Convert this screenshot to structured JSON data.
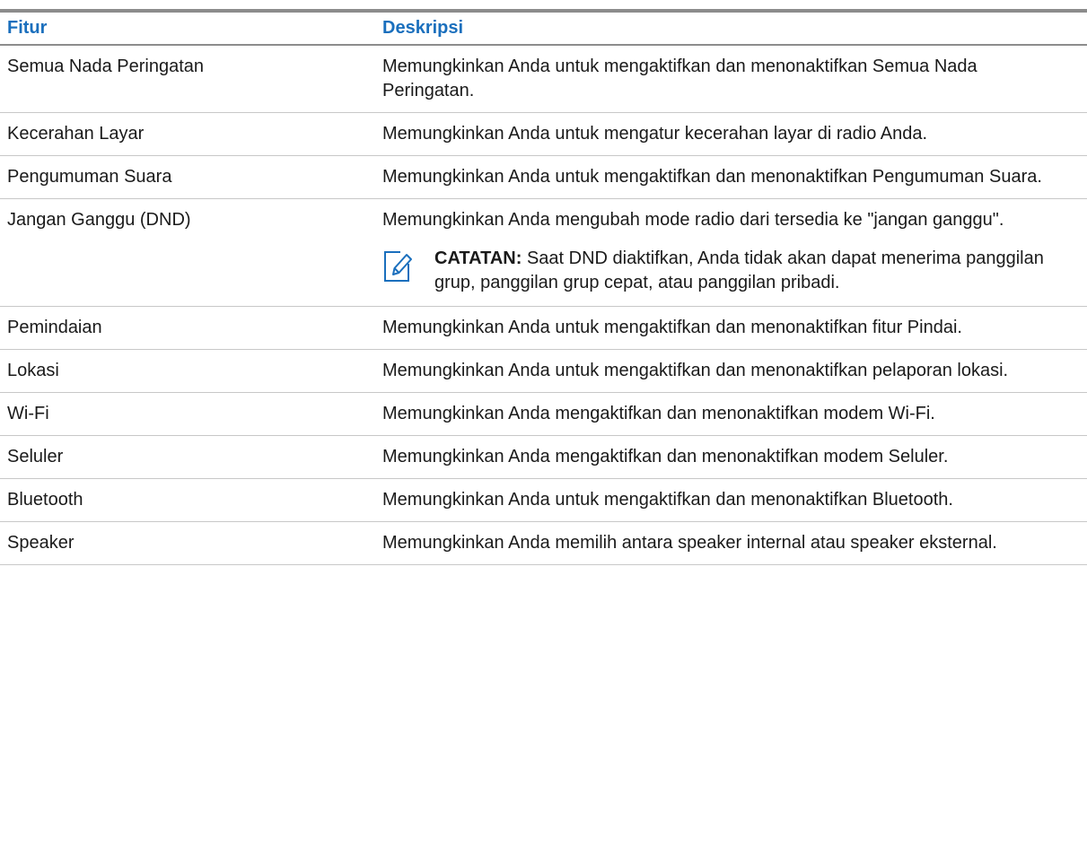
{
  "table": {
    "headers": {
      "feature": "Fitur",
      "description": "Deskripsi"
    },
    "rows": [
      {
        "feature": "Semua Nada Peringatan",
        "description": "Memungkinkan Anda untuk mengaktifkan dan menonaktifkan Semua Nada Peringatan."
      },
      {
        "feature": "Kecerahan Layar",
        "description": "Memungkinkan Anda untuk mengatur kecerahan layar di radio Anda."
      },
      {
        "feature": "Pengumuman Suara",
        "description": "Memungkinkan Anda untuk mengaktifkan dan menonaktifkan Pengumuman Suara."
      },
      {
        "feature": "Jangan Ganggu (DND)",
        "description": "Memungkinkan Anda mengubah mode radio dari tersedia ke \"jangan ganggu\".",
        "note": {
          "icon": "note-edit-icon",
          "label": "CATATAN:",
          "text": "Saat DND diaktifkan, Anda tidak akan dapat menerima panggilan grup, panggilan grup cepat, atau panggilan pribadi."
        }
      },
      {
        "feature": "Pemindaian",
        "description": "Memungkinkan Anda untuk mengaktifkan dan menonaktifkan fitur Pindai."
      },
      {
        "feature": "Lokasi",
        "description": "Memungkinkan Anda untuk mengaktifkan dan menonaktifkan pelaporan lokasi."
      },
      {
        "feature": "Wi-Fi",
        "description": "Memungkinkan Anda mengaktifkan dan menonaktifkan modem Wi-Fi."
      },
      {
        "feature": "Seluler",
        "description": "Memungkinkan Anda mengaktifkan dan menonaktifkan modem Seluler."
      },
      {
        "feature": "Bluetooth",
        "description": "Memungkinkan Anda untuk mengaktifkan dan menonaktifkan Bluetooth."
      },
      {
        "feature": "Speaker",
        "description": "Memungkinkan Anda memilih antara speaker internal atau speaker eksternal."
      }
    ]
  },
  "colors": {
    "header_text": "#1a6fbd",
    "rule": "#8c8c8c",
    "row_divider": "#c8c8c8",
    "note_icon": "#1a6fbd"
  }
}
